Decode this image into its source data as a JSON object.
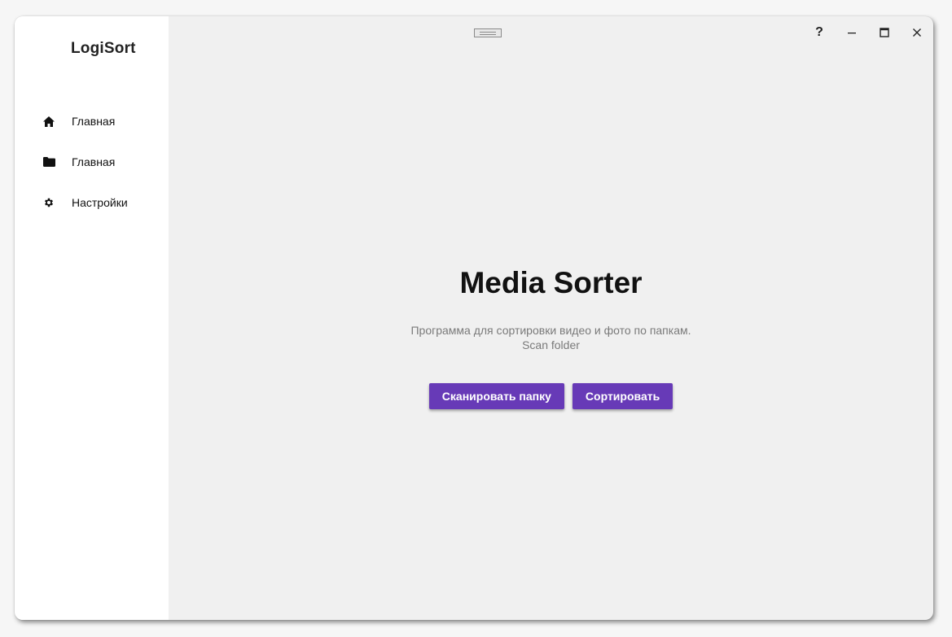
{
  "app": {
    "title": "LogiSort"
  },
  "sidebar": {
    "items": [
      {
        "label": "Главная",
        "icon": "home-icon"
      },
      {
        "label": "Главная",
        "icon": "folder-icon"
      },
      {
        "label": "Настройки",
        "icon": "gear-icon"
      }
    ]
  },
  "window_controls": {
    "help": "?",
    "minimize": "–",
    "maximize": "□",
    "close": "✕"
  },
  "main": {
    "headline": "Media Sorter",
    "description_line1": "Программа для сортировки видео и фото по папкам.",
    "description_line2": "Scan folder",
    "scan_button": "Сканировать папку",
    "sort_button": "Сортировать"
  },
  "colors": {
    "accent": "#673ab7",
    "sidebar_bg": "#ffffff",
    "content_bg": "#f0f0f0"
  }
}
